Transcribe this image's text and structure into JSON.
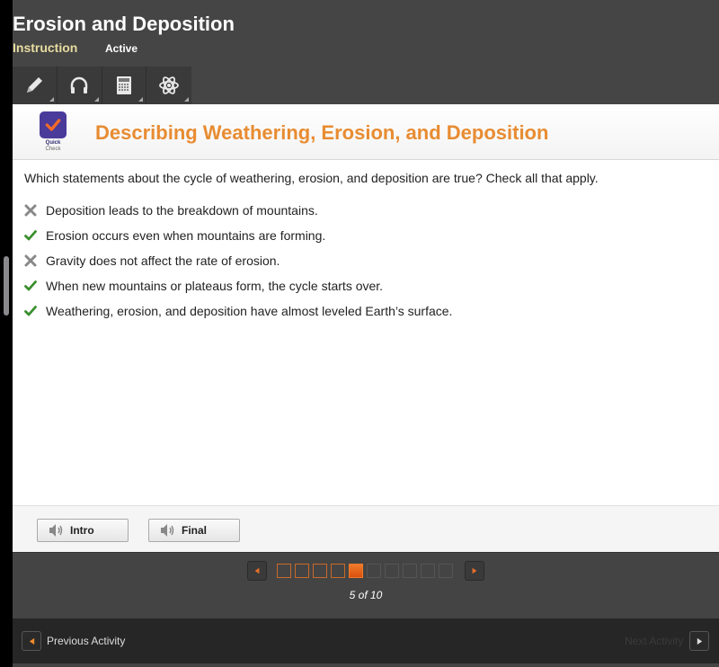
{
  "header": {
    "title": "Erosion and Deposition",
    "tabs": [
      {
        "label": "Instruction",
        "state": "selected"
      },
      {
        "label": "Active"
      }
    ],
    "toolbar": [
      {
        "icon": "pencil-icon"
      },
      {
        "icon": "headphones-icon"
      },
      {
        "icon": "calculator-icon"
      },
      {
        "icon": "atom-icon"
      }
    ]
  },
  "activity": {
    "badge_line1": "Quick",
    "badge_line2": "Check",
    "title": "Describing Weathering, Erosion, and Deposition",
    "question": "Which statements about the cycle of weathering, erosion, and deposition are true? Check all that apply.",
    "answers": [
      {
        "text": "Deposition leads to the breakdown of mountains.",
        "mark": "x-icon",
        "correct": false
      },
      {
        "text": "Erosion occurs even when mountains are forming.",
        "mark": "check-icon",
        "correct": true
      },
      {
        "text": "Gravity does not affect the rate of erosion.",
        "mark": "x-icon",
        "correct": false
      },
      {
        "text": "When new mountains or plateaus form, the cycle starts over.",
        "mark": "check-icon",
        "correct": true
      },
      {
        "text": "Weathering, erosion, and deposition have almost leveled Earth’s surface.",
        "mark": "check-icon",
        "correct": true
      }
    ],
    "audio_buttons": [
      {
        "label": "Intro",
        "icon": "speaker-icon"
      },
      {
        "label": "Final",
        "icon": "speaker-icon"
      }
    ]
  },
  "pager": {
    "current": 5,
    "total": 10,
    "label": "5 of 10"
  },
  "footer": {
    "previous_label": "Previous Activity",
    "next_label": "Next Activity"
  },
  "colors": {
    "accent_orange": "#e88c32",
    "correct_green": "#3a8f2e",
    "incorrect_gray": "#888888",
    "header_bg": "#454545",
    "instruction_tab": "#e8dca0"
  }
}
